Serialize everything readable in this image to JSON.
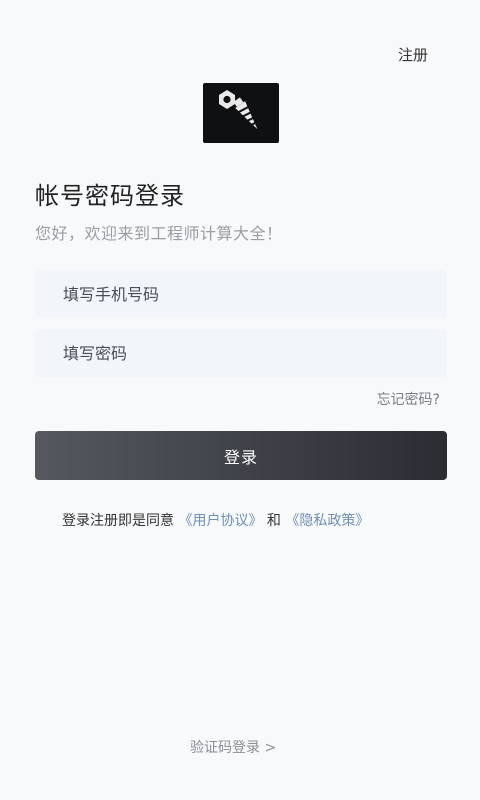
{
  "header": {
    "register_label": "注册"
  },
  "logo": {
    "icon": "screw-nut-icon"
  },
  "title": "帐号密码登录",
  "subtitle": "您好，欢迎来到工程师计算大全！",
  "form": {
    "phone_placeholder": "填写手机号码",
    "phone_value": "",
    "password_placeholder": "填写密码",
    "password_value": "",
    "forgot_label": "忘记密码?",
    "login_label": "登录"
  },
  "agreement": {
    "prefix": "登录注册即是同意",
    "user_agreement": "《用户协议》",
    "and": "和",
    "privacy_policy": "《隐私政策》"
  },
  "footer": {
    "sms_login_label": "验证码登录 >"
  },
  "colors": {
    "background": "#f8f9fb",
    "button": "#3a3c42",
    "link": "#6f8fb7"
  }
}
